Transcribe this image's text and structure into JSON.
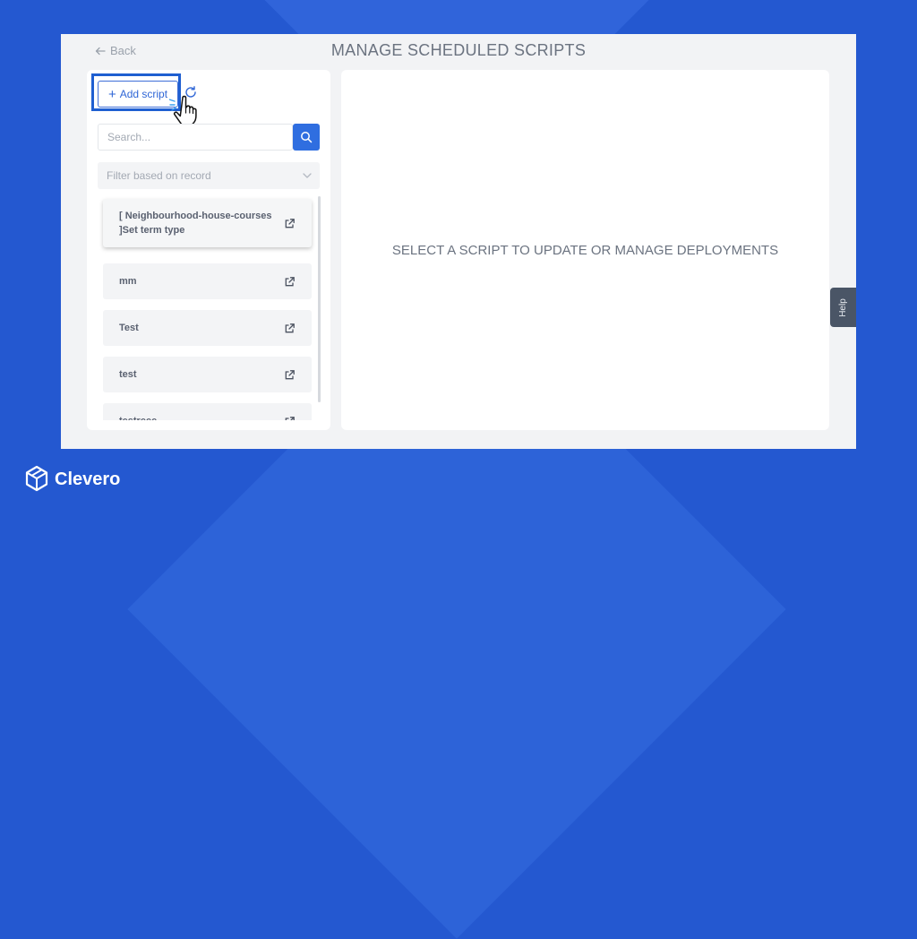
{
  "header": {
    "back_label": "Back",
    "title": "MANAGE SCHEDULED SCRIPTS"
  },
  "toolbar": {
    "add_label": "Add script"
  },
  "search": {
    "placeholder": "Search..."
  },
  "filter": {
    "placeholder": "Filter based on record"
  },
  "scripts": [
    {
      "label": "[ Neighbourhood-house-courses ]Set term type"
    },
    {
      "label": "mm"
    },
    {
      "label": "Test"
    },
    {
      "label": "test"
    },
    {
      "label": "testreee"
    }
  ],
  "main": {
    "placeholder_message": "SELECT A SCRIPT TO UPDATE OR MANAGE DEPLOYMENTS"
  },
  "help": {
    "label": "Help"
  },
  "brand": {
    "name": "Clevero"
  },
  "colors": {
    "background": "#2458d0",
    "accent": "#2f6ee0"
  }
}
